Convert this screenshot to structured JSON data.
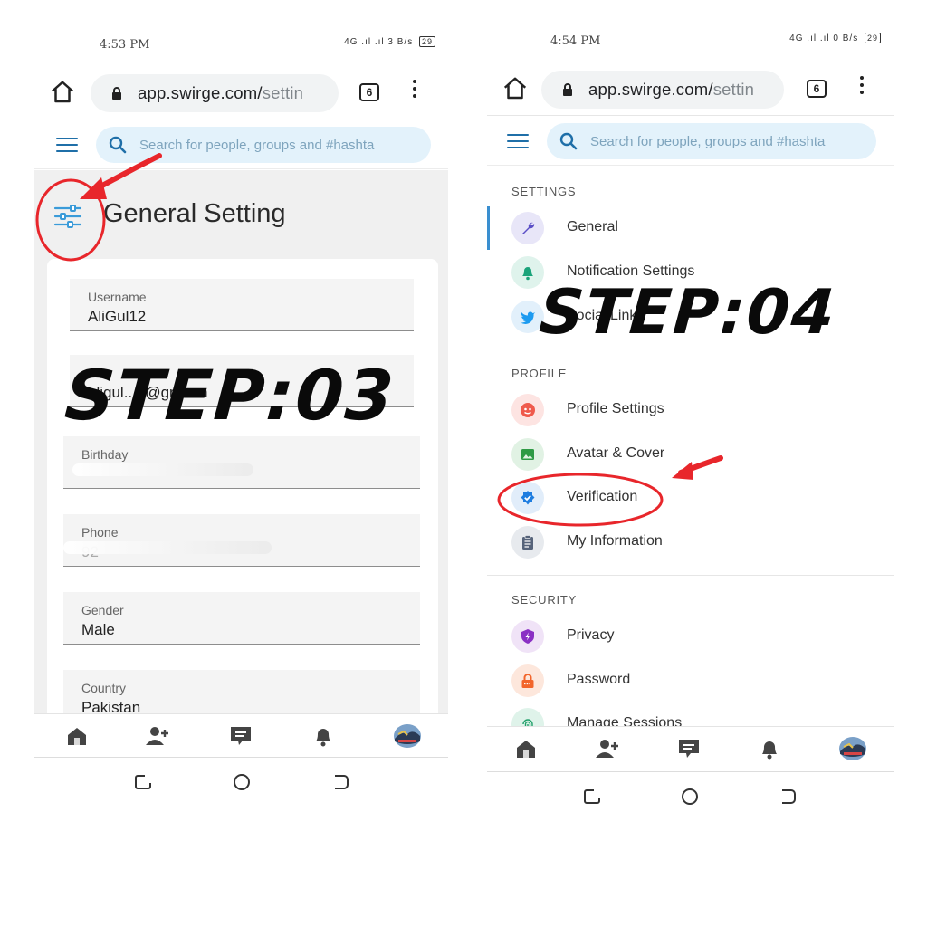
{
  "left": {
    "status": {
      "time": "4:53 PM",
      "signal": "4G .ıl .ıl",
      "speed": "3 B/s",
      "battery": "29"
    },
    "browser": {
      "domain": "app.swirge.com/",
      "path": "settin",
      "tabs_count": "6"
    },
    "search": {
      "placeholder": "Search for people, groups and #hashta"
    },
    "page_title": "General Setting",
    "fields": [
      {
        "label": "Username",
        "value": "AliGul12"
      },
      {
        "label": "E",
        "value": "aligul...9@gm...m"
      },
      {
        "label": "Birthday",
        "value": ""
      },
      {
        "label": "Phone",
        "value": "92"
      },
      {
        "label": "Gender",
        "value": "Male"
      },
      {
        "label": "Country",
        "value": "Pakistan"
      }
    ],
    "annotation": "STEP:03"
  },
  "right": {
    "status": {
      "time": "4:54 PM",
      "signal": "4G .ıl .ıl",
      "speed": "0 B/s",
      "battery": "29"
    },
    "browser": {
      "domain": "app.swirge.com/",
      "path": "settin",
      "tabs_count": "6"
    },
    "search": {
      "placeholder": "Search for people, groups and #hashta"
    },
    "sections": {
      "settings": "SETTINGS",
      "profile": "PROFILE",
      "security": "SECURITY"
    },
    "items": {
      "general": "General",
      "notification": "Notification Settings",
      "social": "Social Links",
      "profile_settings": "Profile Settings",
      "avatar": "Avatar & Cover",
      "verification": "Verification",
      "my_info": "My Information",
      "privacy": "Privacy",
      "password": "Password",
      "sessions": "Manage Sessions"
    },
    "annotation": "STEP:04"
  },
  "colors": {
    "accent": "#1f6fa8",
    "search_bg": "#e3f2fb",
    "annotation_red": "#e8262b",
    "active_bar": "#3a8fd0"
  },
  "icons": [
    "home-icon",
    "lock-icon",
    "search-icon",
    "hamburger-icon",
    "filter-icon",
    "wrench-icon",
    "bell-icon",
    "twitter-icon",
    "user-icon",
    "image-icon",
    "verified-icon",
    "clipboard-icon",
    "shield-icon",
    "lock-icon",
    "fingerprint-icon",
    "add-user-icon",
    "chat-icon",
    "avatar"
  ]
}
